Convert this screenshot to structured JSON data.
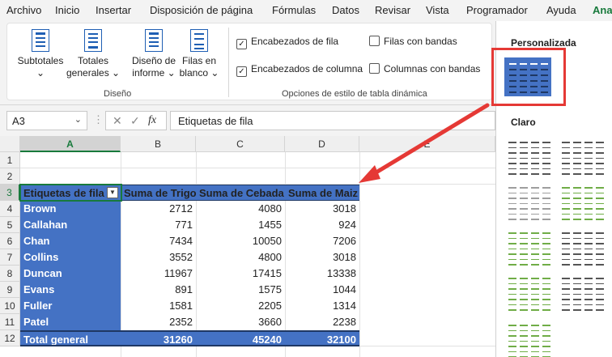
{
  "menu": [
    "Archivo",
    "Inicio",
    "Insertar",
    "Disposición de página",
    "Fórmulas",
    "Datos",
    "Revisar",
    "Vista",
    "Programador",
    "Ayuda",
    "Ana"
  ],
  "ribbon": {
    "buttons": [
      {
        "line1": "Subtotales",
        "line2": "⌄"
      },
      {
        "line1": "Totales",
        "line2": "generales ⌄"
      },
      {
        "line1": "Diseño de",
        "line2": "informe ⌄"
      },
      {
        "line1": "Filas en",
        "line2": "blanco ⌄"
      }
    ],
    "group_design": "Diseño",
    "options": [
      {
        "label": "Encabezados de fila",
        "checked": true
      },
      {
        "label": "Encabezados de columna",
        "checked": true
      },
      {
        "label": "Filas con bandas",
        "checked": false
      },
      {
        "label": "Columnas con bandas",
        "checked": false
      }
    ],
    "group_options": "Opciones de estilo de tabla dinámica"
  },
  "formula_bar": {
    "name_box": "A3",
    "cancel": "✕",
    "enter": "✓",
    "fx": "fx",
    "content": "Etiquetas de fila"
  },
  "grid": {
    "columns": [
      "A",
      "B",
      "C",
      "D",
      "E"
    ],
    "rows": [
      "1",
      "2",
      "3",
      "4",
      "5",
      "6",
      "7",
      "8",
      "9",
      "10",
      "11",
      "12"
    ],
    "header": [
      "Etiquetas de fila",
      "Suma de Trigo",
      "Suma de Cebada",
      "Suma de Maiz"
    ],
    "data": [
      [
        "Brown",
        "2712",
        "4080",
        "3018"
      ],
      [
        "Callahan",
        "771",
        "1455",
        "924"
      ],
      [
        "Chan",
        "7434",
        "10050",
        "7206"
      ],
      [
        "Collins",
        "3552",
        "4800",
        "3018"
      ],
      [
        "Duncan",
        "11967",
        "17415",
        "13338"
      ],
      [
        "Evans",
        "891",
        "1575",
        "1044"
      ],
      [
        "Fuller",
        "1581",
        "2205",
        "1314"
      ],
      [
        "Patel",
        "2352",
        "3660",
        "2238"
      ]
    ],
    "total": [
      "Total general",
      "31260",
      "45240",
      "32100"
    ]
  },
  "gallery": {
    "custom_title": "Personalizada",
    "light_title": "Claro"
  },
  "colors": {
    "accent": "#187a3c",
    "pivot_blue": "#4472c4",
    "highlight": "#e53935"
  }
}
